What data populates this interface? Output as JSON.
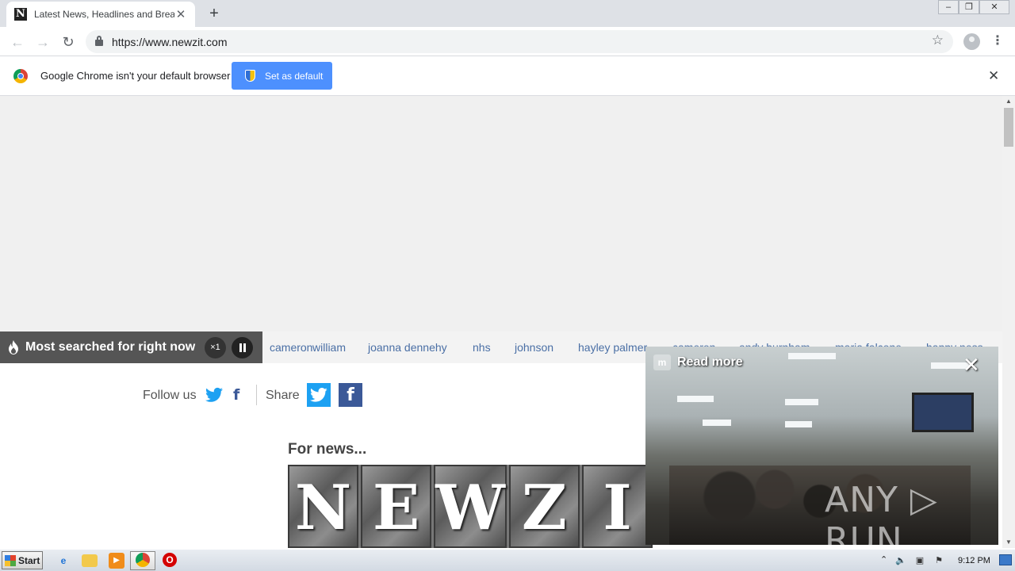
{
  "browser": {
    "tab": {
      "title": "Latest News, Headlines and Breaking News",
      "favicon": "N"
    },
    "new_tab_label": "+",
    "url": "https://www.newzit.com",
    "window_controls": [
      "–",
      "❐",
      "✕"
    ]
  },
  "infobar": {
    "message": "Google Chrome isn't your default browser",
    "button_label": "Set as default",
    "close": "✕"
  },
  "trending": {
    "header": "Most searched for right now",
    "speed": "×1",
    "links": [
      "cameron",
      "william",
      "joanna dennehy",
      "nhs",
      "johnson",
      "hayley palmer",
      "cameron",
      "andy burnham",
      "maria falcone",
      "happy ness"
    ]
  },
  "social": {
    "follow_label": "Follow us",
    "share_label": "Share",
    "facebook_glyph": "f"
  },
  "promo": {
    "heading": "For news...",
    "logo_letters": [
      "N",
      "E",
      "W",
      "Z",
      "I"
    ]
  },
  "video": {
    "read_more": "Read more",
    "icon_text": "m",
    "close": "✕",
    "watermark": "ANY ▷ RUN"
  },
  "taskbar": {
    "start_label": "Start",
    "clock": "9:12 PM"
  },
  "colors": {
    "accent_button": "#4d90fe",
    "twitter": "#1da1f2",
    "facebook": "#3b5998",
    "trend_link": "#4a6fa5"
  }
}
